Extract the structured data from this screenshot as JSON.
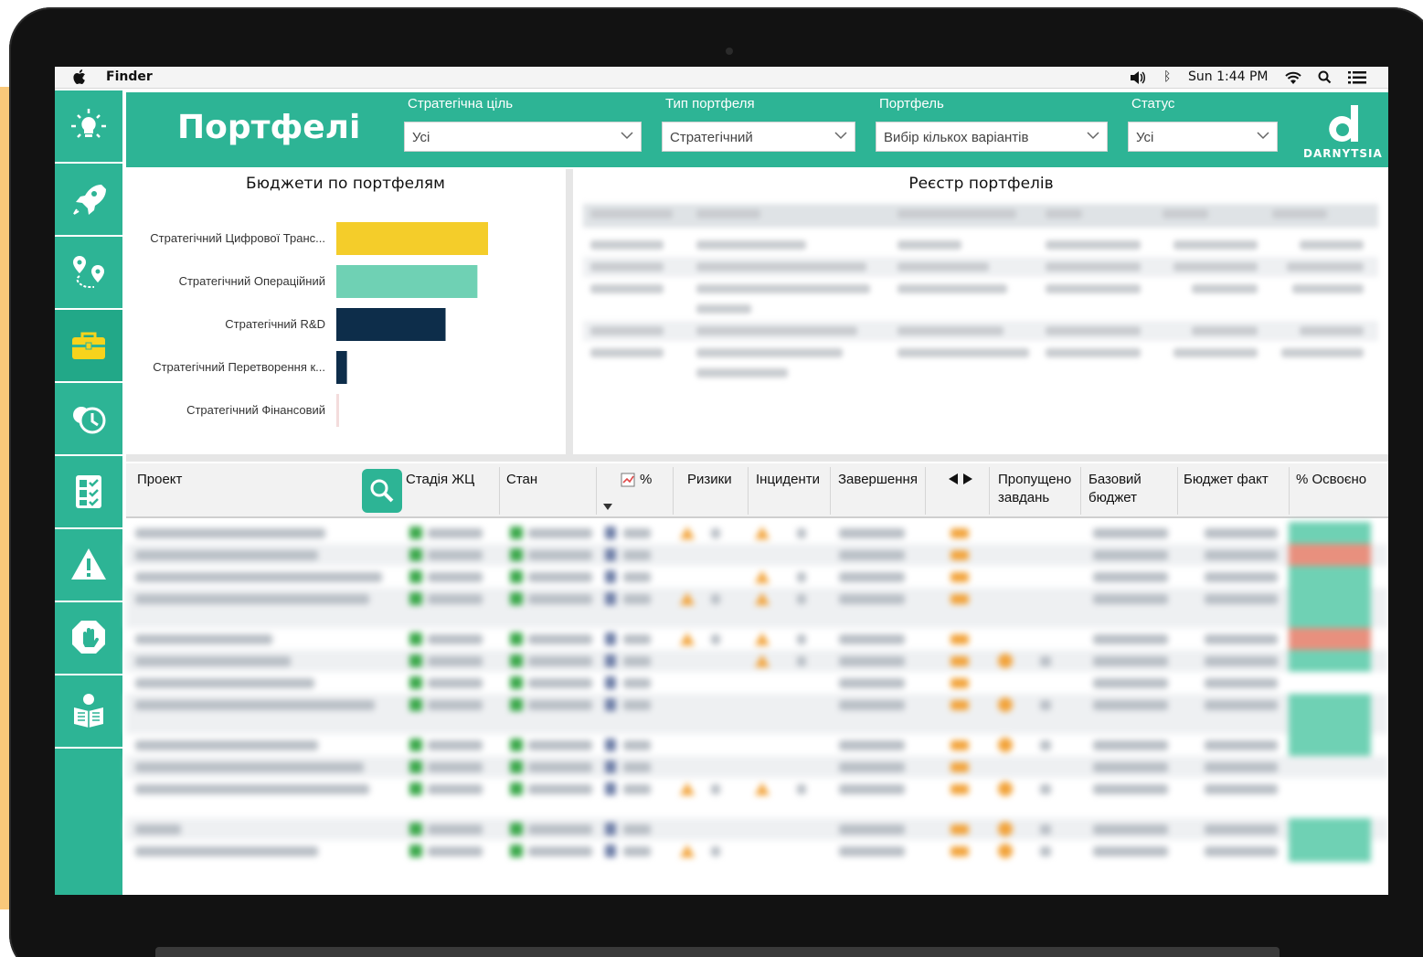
{
  "menubar": {
    "app_name": "Finder",
    "clock": "Sun 1:44 PM",
    "icons": [
      "apple-icon",
      "volume-icon",
      "bluetooth-icon",
      "wifi-icon",
      "spotlight-icon",
      "list-icon"
    ]
  },
  "sidebar": {
    "items": [
      {
        "name": "lightbulb-icon"
      },
      {
        "name": "rocket-icon"
      },
      {
        "name": "map-pins-icon"
      },
      {
        "name": "briefcase-icon",
        "active": true
      },
      {
        "name": "clock-history-icon"
      },
      {
        "name": "checklist-icon"
      },
      {
        "name": "warning-icon"
      },
      {
        "name": "stop-hand-icon"
      },
      {
        "name": "reader-icon"
      }
    ]
  },
  "header": {
    "title": "Портфелі",
    "brand": "DARNYTSIA",
    "filters": [
      {
        "label": "Стратегічна ціль",
        "value": "Усі"
      },
      {
        "label": "Тип портфеля",
        "value": "Стратегічний"
      },
      {
        "label": "Портфель",
        "value": "Вибір кількох варіантів"
      },
      {
        "label": "Статус",
        "value": "Усі"
      }
    ]
  },
  "budget_panel": {
    "title": "Бюджети по портфелям"
  },
  "chart_data": {
    "type": "bar",
    "orientation": "horizontal",
    "categories": [
      "Стратегічний Цифрової Транс...",
      "Стратегічний Операційний",
      "Стратегічний R&D",
      "Стратегічний Перетворення к...",
      "Стратегічний Фінансовий"
    ],
    "values": [
      100,
      93,
      72,
      7,
      1
    ],
    "colors": [
      "#f4cd2a",
      "#6fd1b4",
      "#0d2d4a",
      "#0d2d4a",
      "#f3dcdc"
    ],
    "value_labels_visible": false
  },
  "registry_panel": {
    "title": "Реєстр портфелів"
  },
  "table": {
    "headers": {
      "project": "Проект",
      "stage": "Стадія ЖЦ",
      "state": "Стан",
      "percent": "%",
      "risks": "Ризики",
      "incidents": "Інциденти",
      "completion": "Завершення",
      "missed_line1": "Пропущено",
      "missed_line2": "завдань",
      "base_line1": "Базовий",
      "base_line2": "бюджет",
      "actual": "Бюджет факт",
      "absorbed": "% Освоєно"
    }
  },
  "colors": {
    "accent": "#2db495",
    "yellow_bar": "#f4cd2a",
    "mint_bar": "#6fd1b4",
    "navy_bar": "#0d2d4a",
    "orange_status": "#f2a33a",
    "green_status": "#3aa84a",
    "red_status": "#e8907e"
  }
}
